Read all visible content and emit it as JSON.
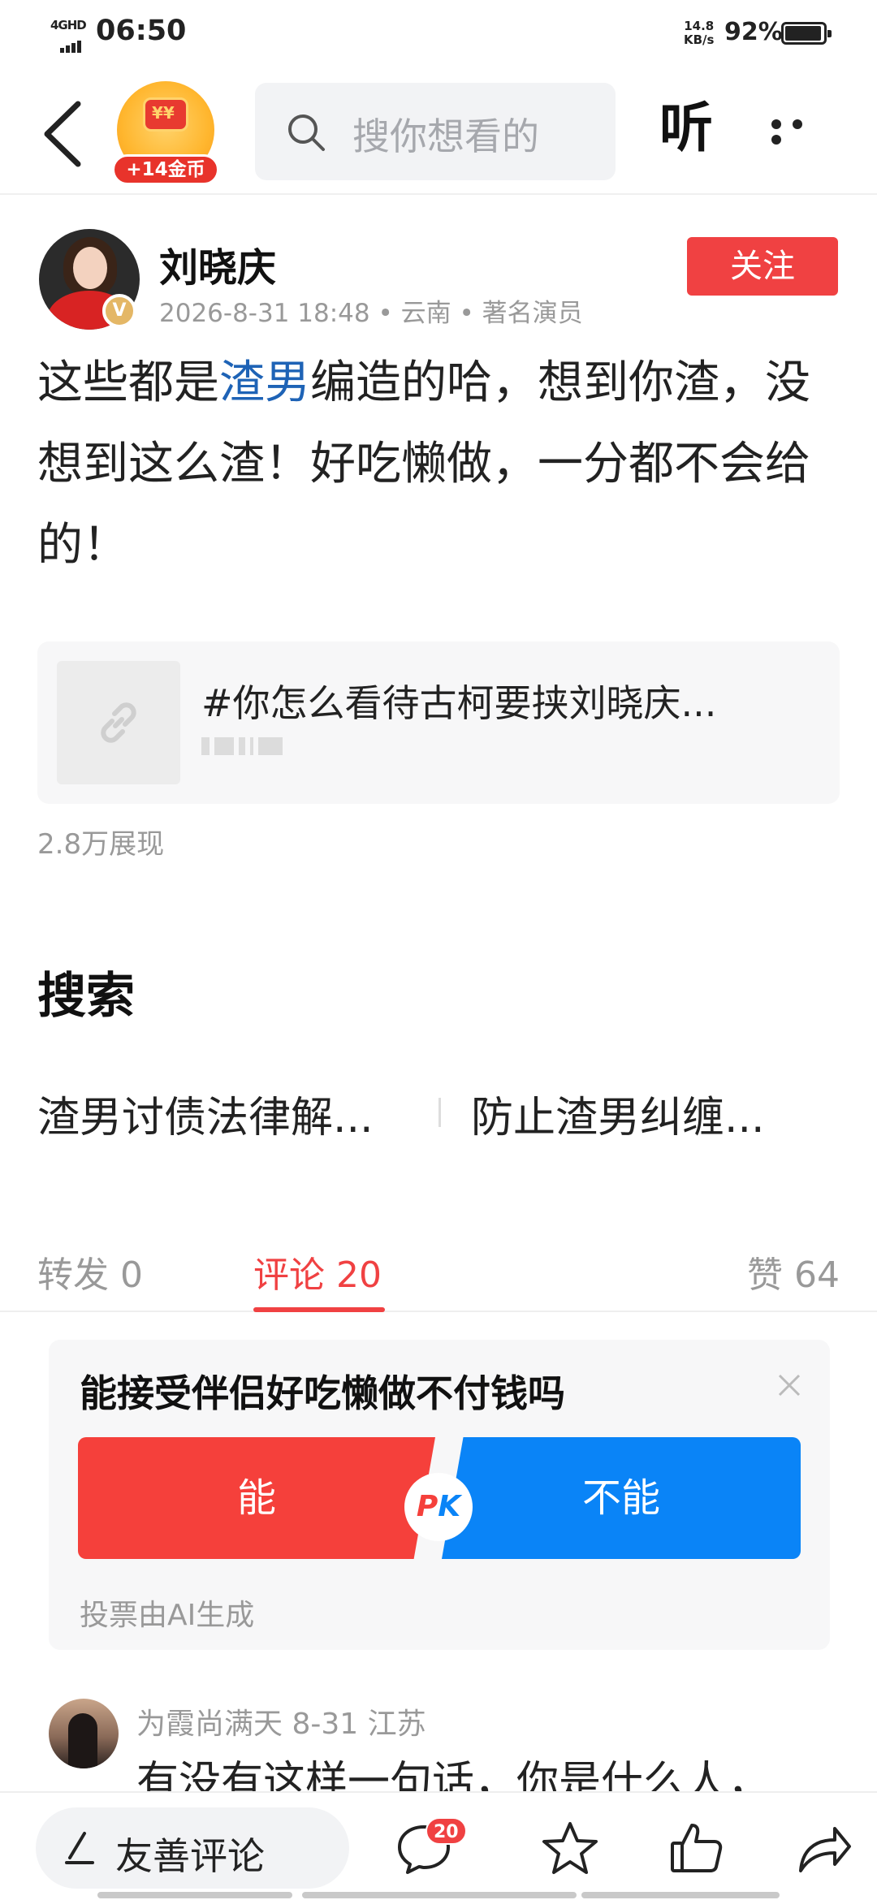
{
  "status_bar": {
    "network": "4GHD",
    "time": "06:50",
    "speed_value": "14.8",
    "speed_unit": "KB/s",
    "battery": "92%"
  },
  "topnav": {
    "coin_label": "+14金币",
    "search_placeholder": "搜你想看的",
    "listen_label": "听",
    "icons": [
      "back-arrow-icon",
      "red-envelope-icon",
      "search-icon",
      "more-dots-icon"
    ]
  },
  "post": {
    "author": "刘晓庆",
    "verified_badge": "V",
    "meta": "2026-8-31 18:48 • 云南 • 著名演员",
    "follow_label": "关注",
    "text_before": "这些都是",
    "text_highlight": "渣男",
    "text_after": "编造的哈，想到你渣，没想到这么渣！好吃懒做，一分都不会给的！",
    "link_title": "#你怎么看待古柯要挟刘晓庆...",
    "views": "2.8万展现"
  },
  "search_section": {
    "heading": "搜索",
    "suggestions": [
      "渣男讨债法律解...",
      "防止渣男纠缠..."
    ]
  },
  "tabs": {
    "repost": "转发 0",
    "comments": "评论 20",
    "likes": "赞 64",
    "active": "comments",
    "active_color": "#f04142"
  },
  "poll": {
    "question": "能接受伴侣好吃懒做不付钱吗",
    "yes": "能",
    "no": "不能",
    "pk_p": "P",
    "pk_k": "K",
    "note": "投票由AI生成",
    "yes_color": "#f5403b",
    "no_color": "#0a84f7"
  },
  "comment": {
    "user_line": "为霞尚满天   8-31   江苏",
    "text": "有没有这样一句话，你是什么人，"
  },
  "bottom_bar": {
    "input_label": "友善评论",
    "comment_count": "20",
    "icons": [
      "pen-icon",
      "comment-bubble-icon",
      "star-icon",
      "thumbs-up-icon",
      "share-arrow-icon"
    ]
  }
}
